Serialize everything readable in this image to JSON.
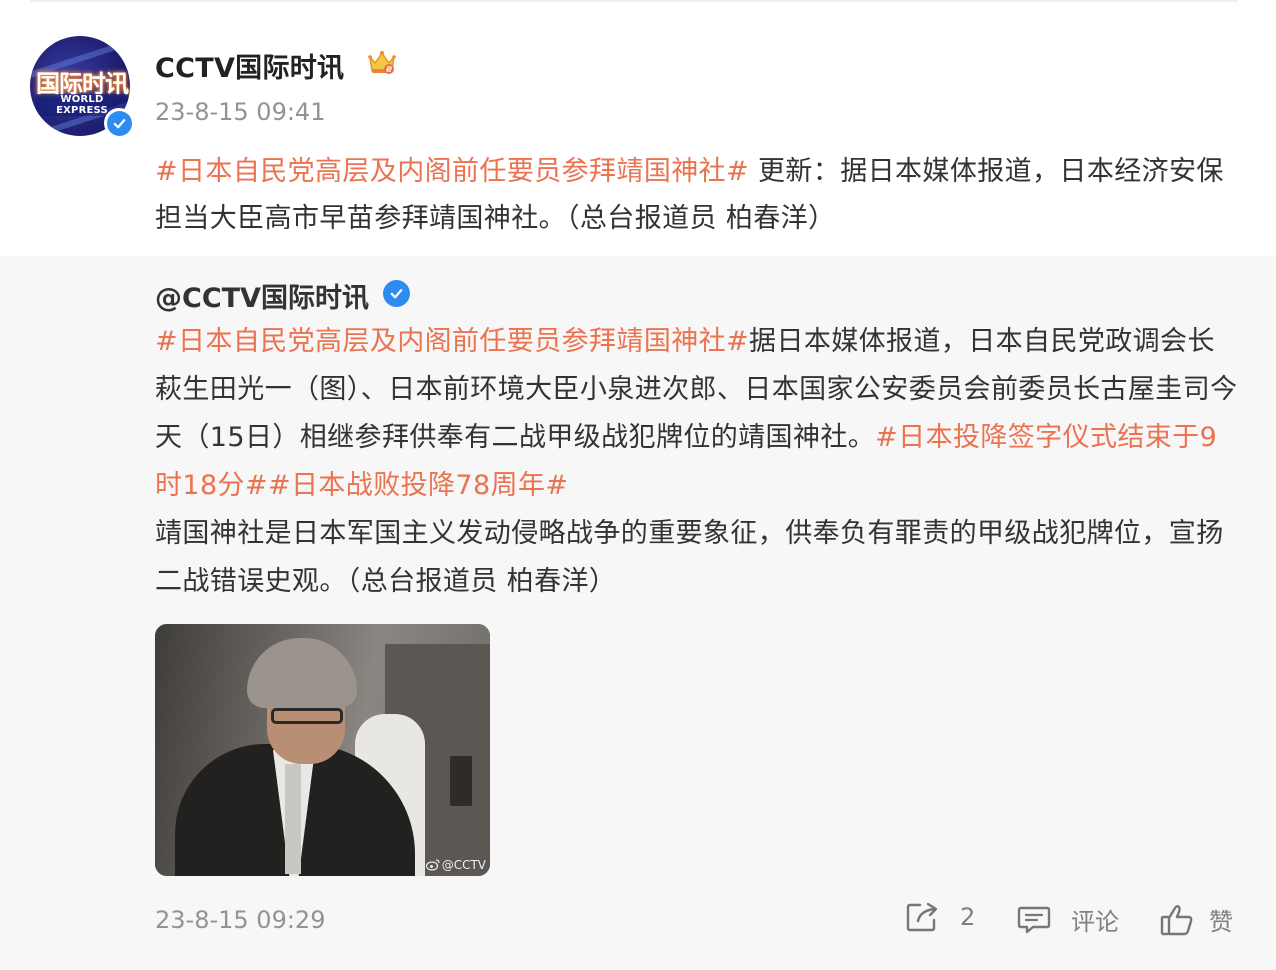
{
  "post": {
    "author": "CCTV国际时讯",
    "avatar_text": "国际时讯",
    "avatar_subtext": "WORLD EXPRESS",
    "time": "23-8-15 09:41",
    "tag": "#日本自民党高层及内阁前任要员参拜靖国神社#",
    "text": " 更新：据日本媒体报道，日本经济安保担当大臣高市早苗参拜靖国神社。（总台报道员 柏春洋）"
  },
  "repost": {
    "author": "@CCTV国际时讯",
    "tag1": "#日本自民党高层及内阁前任要员参拜靖国神社#",
    "text1": "据日本媒体报道，日本自民党政调会长萩生田光一（图）、日本前环境大臣小泉进次郎、日本国家公安委员会前委员长古屋圭司今天（15日）相继参拜供奉有二战甲级战犯牌位的靖国神社。",
    "tag2": "#日本投降签字仪式结束于9时18分#",
    "tag3": "#日本战败投降78周年#",
    "text2": "靖国神社是日本军国主义发动侵略战争的重要象征，供奉负有罪责的甲级战犯牌位，宣扬二战错误史观。（总台报道员 柏春洋）",
    "image_watermark": "@CCTV",
    "time": "23-8-15 09:29",
    "forward_count": "2",
    "comment_label": "评论",
    "like_label": "赞"
  },
  "icons": {
    "verified": "verified-check-icon",
    "crown": "crown-badge-icon",
    "forward": "share-arrow-icon",
    "comment": "comment-bubble-icon",
    "like": "thumbs-up-icon"
  },
  "colors": {
    "tag": "#eb7350",
    "verified": "#2d8cf0",
    "muted": "#939393",
    "repost_bg": "#f7f7f7"
  }
}
